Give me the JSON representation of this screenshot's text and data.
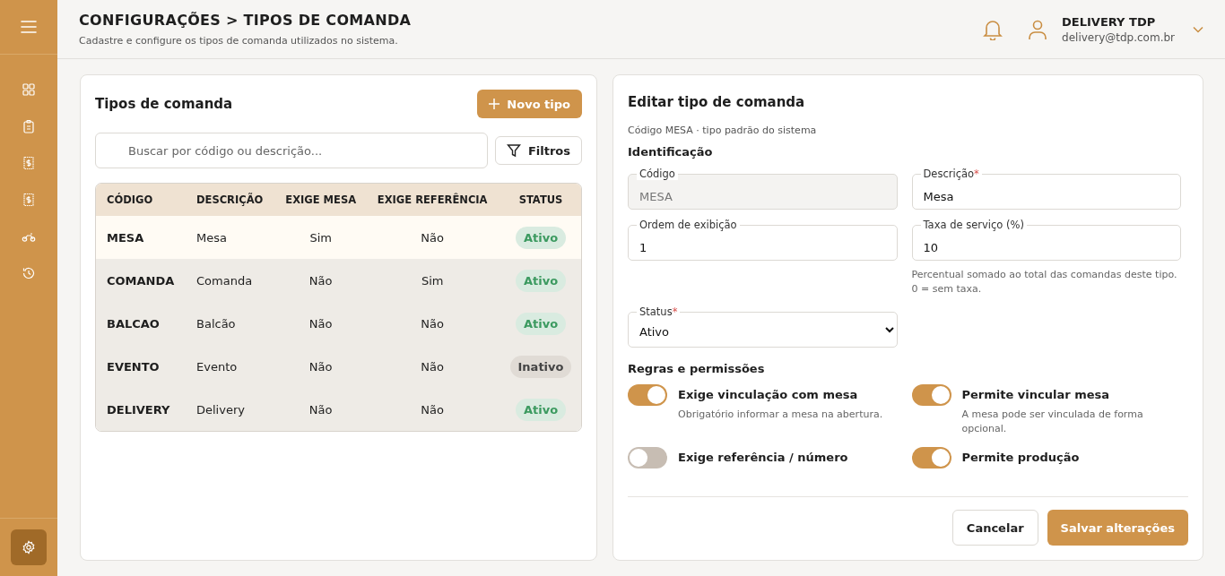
{
  "sidebar": {
    "items": [
      {
        "selected": false
      },
      {
        "selected": false
      },
      {
        "selected": false
      },
      {
        "selected": false
      },
      {
        "selected": false
      },
      {
        "selected": false
      }
    ],
    "bottom_item": {
      "selected": true
    }
  },
  "header": {
    "title": "CONFIGURAÇÕES > TIPOS DE COMANDA",
    "subtitle": "Cadastre e configure os tipos de comanda utilizados no sistema.",
    "user": {
      "name": "DELIVERY TDP",
      "email": "delivery@tdp.com.br"
    }
  },
  "list_panel": {
    "title": "Tipos de comanda",
    "new_button": "Novo tipo",
    "search": {
      "placeholder": "Buscar por código ou descrição..."
    },
    "filter_button": "Filtros",
    "table": {
      "columns": [
        "CÓDIGO",
        "DESCRIÇÃO",
        "EXIGE MESA",
        "EXIGE REFERÊNCIA",
        "STATUS"
      ],
      "rows": [
        {
          "code": "MESA",
          "description": "Mesa",
          "requires_table": "Sim",
          "requires_reference": "Não",
          "status": "Ativo",
          "active": true,
          "selected": true
        },
        {
          "code": "COMANDA",
          "description": "Comanda",
          "requires_table": "Não",
          "requires_reference": "Sim",
          "status": "Ativo",
          "active": true,
          "selected": false
        },
        {
          "code": "BALCAO",
          "description": "Balcão",
          "requires_table": "Não",
          "requires_reference": "Não",
          "status": "Ativo",
          "active": true,
          "selected": false
        },
        {
          "code": "EVENTO",
          "description": "Evento",
          "requires_table": "Não",
          "requires_reference": "Não",
          "status": "Inativo",
          "active": false,
          "selected": false
        },
        {
          "code": "DELIVERY",
          "description": "Delivery",
          "requires_table": "Não",
          "requires_reference": "Não",
          "status": "Ativo",
          "active": true,
          "selected": false
        }
      ]
    }
  },
  "edit_panel": {
    "title": "Editar tipo de comanda",
    "subtitle": "Código MESA · tipo padrão do sistema",
    "section_identification": "Identificação",
    "fields": [
      {
        "kind": "input",
        "label": "Código",
        "value": "MESA",
        "disabled": true
      },
      {
        "kind": "input",
        "label": "Descrição",
        "required_mark": "*",
        "value": "Mesa",
        "disabled": false
      },
      {
        "kind": "input",
        "label": "Ordem de exibição",
        "value": "1",
        "disabled": false
      },
      {
        "kind": "input",
        "label": "Taxa de serviço (%)",
        "value": "10",
        "disabled": false,
        "hint": "Percentual somado ao total das comandas deste tipo. 0 = sem taxa."
      },
      {
        "kind": "select",
        "label": "Status",
        "required_mark": "*",
        "value": "Ativo",
        "disabled": false
      }
    ],
    "section_rules": "Regras e permissões",
    "toggles": [
      {
        "label": "Exige vinculação com mesa",
        "hint": "Obrigatório informar a mesa na abertura.",
        "on": true
      },
      {
        "label": "Permite vincular mesa",
        "hint": "A mesa pode ser vinculada de forma opcional.",
        "on": true
      },
      {
        "label": "Exige referência / número",
        "on": false
      },
      {
        "label": "Permite produção",
        "on": true
      }
    ],
    "cancel_button": "Cancelar",
    "save_button": "Salvar alterações"
  }
}
